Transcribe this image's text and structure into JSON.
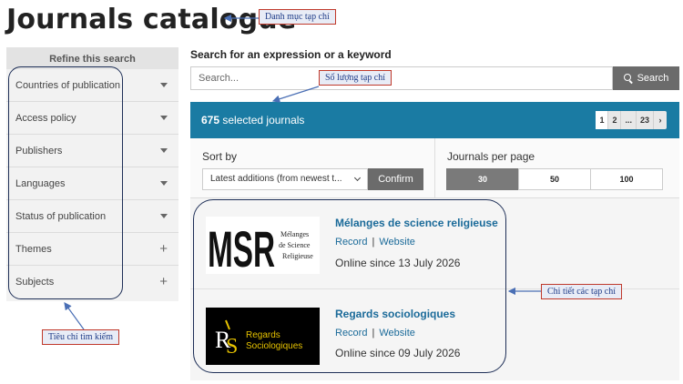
{
  "page": {
    "title": "Journals catalogue"
  },
  "sidebar": {
    "heading": "Refine this search",
    "filters": [
      {
        "label": "Countries of publication",
        "control": "caret"
      },
      {
        "label": "Access policy",
        "control": "caret"
      },
      {
        "label": "Publishers",
        "control": "caret"
      },
      {
        "label": "Languages",
        "control": "caret"
      },
      {
        "label": "Status of publication",
        "control": "caret"
      },
      {
        "label": "Themes",
        "control": "plus"
      },
      {
        "label": "Subjects",
        "control": "plus"
      }
    ]
  },
  "search": {
    "label": "Search for an expression or a keyword",
    "placeholder": "Search...",
    "button_label": "Search"
  },
  "results": {
    "count": "675",
    "suffix": "selected journals",
    "pagination": [
      "1",
      "2",
      "...",
      "23",
      "›"
    ],
    "current_page": "1"
  },
  "sort": {
    "label": "Sort by",
    "selected": "Latest additions (from newest t...",
    "confirm_label": "Confirm"
  },
  "per_page": {
    "label": "Journals per page",
    "options": [
      "30",
      "50",
      "100"
    ],
    "selected": "30"
  },
  "journals": [
    {
      "title": "Mélanges de science religieuse",
      "record_label": "Record",
      "separator": "|",
      "website_label": "Website",
      "online": "Online since 13 July 2026",
      "logo_text": [
        "MSR",
        "Mélanges",
        "de Science",
        "Religieuse"
      ]
    },
    {
      "title": "Regards sociologiques",
      "record_label": "Record",
      "separator": "|",
      "website_label": "Website",
      "online": "Online since 09 July 2026",
      "logo_text": [
        "R",
        "S",
        "Regards",
        "Sociologiques"
      ]
    }
  ],
  "annotations": {
    "title_note": "Danh mục tạp chí",
    "count_note": "Số lượng tạp chí",
    "filters_note": "Tiêu chí tìm kiếm",
    "details_note": "Chi tiết các tạp chí"
  },
  "colors": {
    "results_bar": "#1a7ba3",
    "link": "#1a6a99",
    "button": "#6b6b6b",
    "annotation_border": "#c0392b",
    "annotation_text": "#1f3c88"
  }
}
